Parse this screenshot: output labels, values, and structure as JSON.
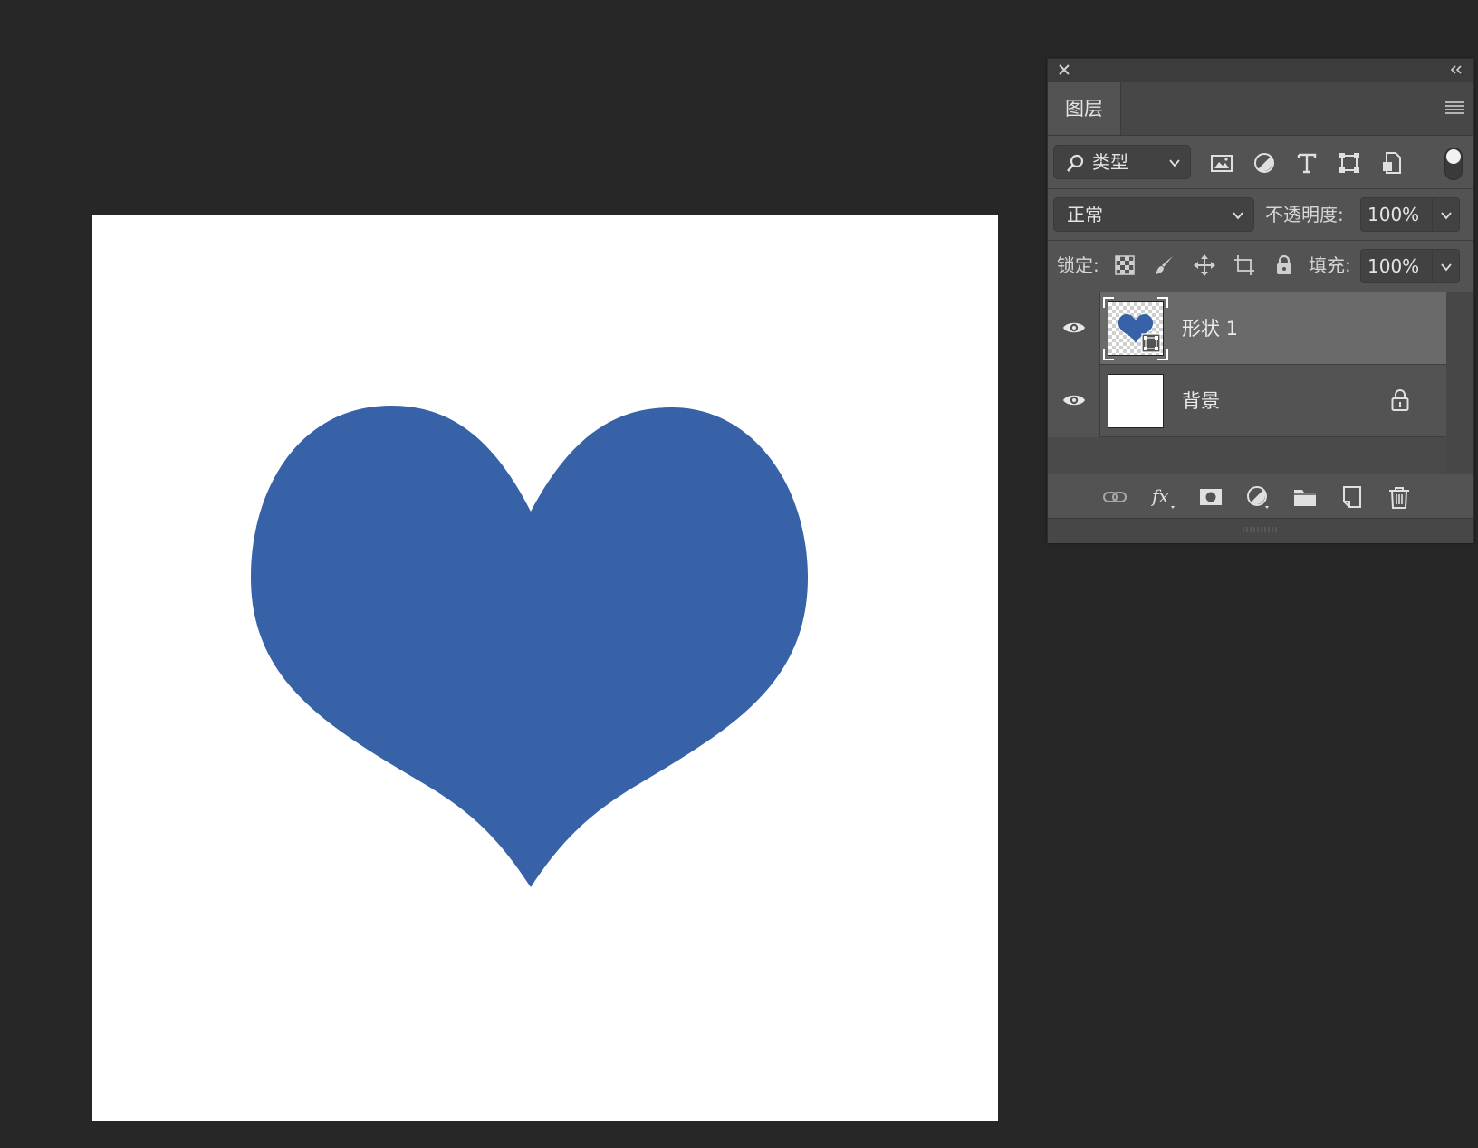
{
  "app": "Photoshop",
  "canvas": {
    "background": "#ffffff",
    "shape": {
      "type": "heart",
      "fill": "#3762a8",
      "icon": "heart-shape"
    }
  },
  "panel": {
    "close_icon": "close-icon",
    "collapse_icon": "double-chevron-left-icon",
    "tab_label": "图层",
    "menu_icon": "panel-menu-icon",
    "filter": {
      "label": "类型",
      "icons": [
        "image-filter-icon",
        "adjustment-filter-icon",
        "type-filter-icon",
        "shape-filter-icon",
        "smart-object-filter-icon"
      ],
      "toggle_on": true
    },
    "blend": {
      "mode": "正常",
      "opacity_label": "不透明度:",
      "opacity_value": "100%"
    },
    "lock": {
      "label": "锁定:",
      "icons": [
        "lock-transparent-pixels-icon",
        "lock-image-pixels-icon",
        "lock-position-icon",
        "lock-artboard-icon",
        "lock-all-icon"
      ],
      "fill_label": "填充:",
      "fill_value": "100%"
    },
    "layers": [
      {
        "name": "形状 1",
        "visible": true,
        "selected": true,
        "locked": false,
        "thumb": "heart-shape-thumbnail"
      },
      {
        "name": "背景",
        "visible": true,
        "selected": false,
        "locked": true,
        "thumb": "white-background-thumbnail"
      }
    ],
    "bottom_icons": [
      "link-layers-icon",
      "fx-icon",
      "add-mask-icon",
      "adjustment-layer-icon",
      "new-group-icon",
      "new-layer-icon",
      "delete-icon"
    ]
  }
}
